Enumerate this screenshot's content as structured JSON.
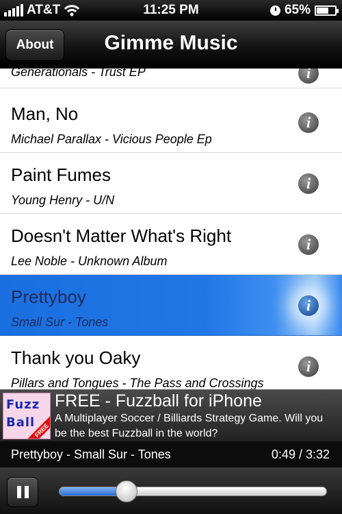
{
  "status_bar": {
    "carrier": "AT&T",
    "time": "11:25 PM",
    "battery_percent": "65%",
    "battery_level": 0.65,
    "icons": [
      "signal-icon",
      "wifi-icon",
      "clock-icon",
      "battery-icon"
    ]
  },
  "nav": {
    "about_label": "About",
    "title": "Gimme Music"
  },
  "songs": [
    {
      "title": "",
      "subtitle": "Generationals - Trust EP",
      "partial": true
    },
    {
      "title": "Man, No",
      "subtitle": "Michael Parallax - Vicious People Ep"
    },
    {
      "title": "Paint Fumes",
      "subtitle": "Young Henry - U/N"
    },
    {
      "title": "Doesn't Matter What's Right",
      "subtitle": "Lee Noble - Unknown Album"
    },
    {
      "title": "Prettyboy",
      "subtitle": "Small Sur - Tones",
      "selected": true
    },
    {
      "title": "Thank you Oaky",
      "subtitle": "Pillars and Tongues - The Pass and Crossings"
    }
  ],
  "info_glyph": "i",
  "ad": {
    "logo_line1": "Fuzz",
    "logo_line2": "Ball",
    "logo_badge": "FREE",
    "title": "FREE - Fuzzball for iPhone",
    "description": "A Multiplayer Soccer / Billiards Strategy Game. Will you be the best Fuzzball in the world?"
  },
  "now_playing": {
    "track": "Prettyboy - Small Sur - Tones",
    "time": "0:49 / 3:32",
    "progress": 0.231
  },
  "colors": {
    "selected_row": "#1f73e3",
    "slider_fill": "#2b6fd0"
  }
}
